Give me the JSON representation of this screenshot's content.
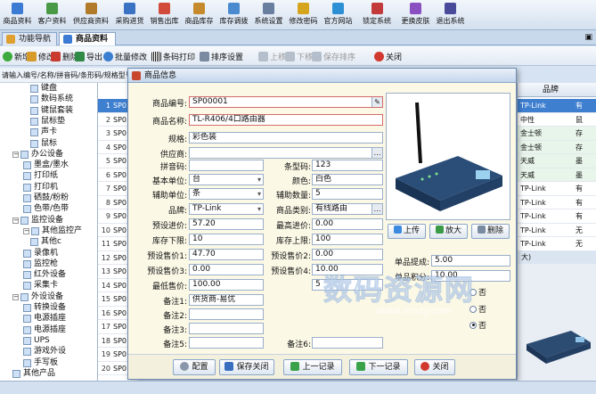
{
  "menu": [
    {
      "label": "商品资料",
      "icon": "grid-icon",
      "color": "#3b7bd3"
    },
    {
      "label": "客户资料",
      "icon": "people-icon",
      "color": "#4a9a45"
    },
    {
      "label": "供应商资料",
      "icon": "truck-icon",
      "color": "#b27b2a"
    },
    {
      "label": "采购进货",
      "icon": "cart-icon",
      "color": "#3a72c4"
    },
    {
      "label": "销售出库",
      "icon": "shop-icon",
      "color": "#d24a3a"
    },
    {
      "label": "商品库存",
      "icon": "box-icon",
      "color": "#c58a2b"
    },
    {
      "label": "库存调拨",
      "icon": "transfer-icon",
      "color": "#4a8bd0"
    },
    {
      "label": "系统设置",
      "icon": "gear-icon",
      "color": "#6a7ea0"
    },
    {
      "label": "修改密码",
      "icon": "key-icon",
      "color": "#d6a51e"
    },
    {
      "label": "官方网站",
      "icon": "globe-icon",
      "color": "#2d8fd4"
    },
    {
      "label": "锁定系统",
      "icon": "lock-icon",
      "color": "#c23a3a"
    },
    {
      "label": "更换皮肤",
      "icon": "palette-icon",
      "color": "#8a4fc0"
    },
    {
      "label": "退出系统",
      "icon": "exit-icon",
      "color": "#4a4a9a"
    }
  ],
  "tabs": [
    {
      "label": "功能导航"
    },
    {
      "label": "商品资料"
    }
  ],
  "toolbar": {
    "new": "新增",
    "edit": "修改",
    "delete": "删除",
    "export": "导出",
    "batch_edit": "批量修改",
    "barcode_print": "条码打印",
    "sort_settings": "排序设置",
    "move_up": "上移",
    "move_down": "下移",
    "save_sort": "保存排序",
    "close": "关闭"
  },
  "breadcrumb": "请输入编号/名称/拼音码/条形码/规格型号",
  "tree": [
    {
      "label": "键盘",
      "level": 3
    },
    {
      "label": "数码系统",
      "level": 3
    },
    {
      "label": "键鼠套装",
      "level": 3
    },
    {
      "label": "鼠标垫",
      "level": 3
    },
    {
      "label": "声卡",
      "level": 3
    },
    {
      "label": "鼠标",
      "level": 3
    },
    {
      "label": "办公设备",
      "level": 1,
      "expanded": true
    },
    {
      "label": "墨盒/墨水",
      "level": 2
    },
    {
      "label": "打印纸",
      "level": 2
    },
    {
      "label": "打印机",
      "level": 2
    },
    {
      "label": "硒鼓/粉粉",
      "level": 2
    },
    {
      "label": "色带/色带",
      "level": 2
    },
    {
      "label": "监控设备",
      "level": 1,
      "expanded": true
    },
    {
      "label": "其他监控产",
      "level": 2,
      "expanded": true
    },
    {
      "label": "其他c",
      "level": 3
    },
    {
      "label": "录像机",
      "level": 2
    },
    {
      "label": "监控枪",
      "level": 2
    },
    {
      "label": "红外设备",
      "level": 2
    },
    {
      "label": "采集卡",
      "level": 2
    },
    {
      "label": "外设设备",
      "level": 1,
      "expanded": true
    },
    {
      "label": "转换设备",
      "level": 2
    },
    {
      "label": "电源插座",
      "level": 2
    },
    {
      "label": "电源插座",
      "level": 2
    },
    {
      "label": "UPS",
      "level": 2
    },
    {
      "label": "游戏外设",
      "level": 2
    },
    {
      "label": "手写板",
      "level": 2
    },
    {
      "label": "其他产品",
      "level": 1
    }
  ],
  "grid_rows": [
    {
      "num": "1",
      "code": "SP0"
    },
    {
      "num": "2",
      "code": "SP0"
    },
    {
      "num": "3",
      "code": "SP0"
    },
    {
      "num": "4",
      "code": "SP0"
    },
    {
      "num": "5",
      "code": "SP0"
    },
    {
      "num": "6",
      "code": "SP0"
    },
    {
      "num": "7",
      "code": "SP0"
    },
    {
      "num": "8",
      "code": "SP0"
    },
    {
      "num": "9",
      "code": "SP0"
    },
    {
      "num": "10",
      "code": "SP0"
    },
    {
      "num": "11",
      "code": "SP0"
    },
    {
      "num": "12",
      "code": "SP0"
    },
    {
      "num": "13",
      "code": "SP0"
    },
    {
      "num": "14",
      "code": "SP0"
    },
    {
      "num": "15",
      "code": "SP0"
    },
    {
      "num": "16",
      "code": "SP0"
    },
    {
      "num": "17",
      "code": "SP0"
    },
    {
      "num": "18",
      "code": "SP0"
    },
    {
      "num": "19",
      "code": "SP0"
    },
    {
      "num": "20",
      "code": "SP0"
    }
  ],
  "right_grid": {
    "header": "品牌",
    "rows": [
      {
        "brand": "TP-Link",
        "extra": "有",
        "tint": false
      },
      {
        "brand": "中性",
        "extra": "鼠",
        "tint": false
      },
      {
        "brand": "金士顿",
        "extra": "存",
        "tint": true
      },
      {
        "brand": "金士顿",
        "extra": "存",
        "tint": true
      },
      {
        "brand": "天威",
        "extra": "墨",
        "tint": true
      },
      {
        "brand": "天威",
        "extra": "墨",
        "tint": true
      },
      {
        "brand": "TP-Link",
        "extra": "有",
        "tint": false
      },
      {
        "brand": "TP-Link",
        "extra": "有",
        "tint": false
      },
      {
        "brand": "TP-Link",
        "extra": "有",
        "tint": false
      },
      {
        "brand": "TP-Link",
        "extra": "无",
        "tint": false
      },
      {
        "brand": "TP-Link",
        "extra": "无",
        "tint": false
      }
    ],
    "image_label": "大)"
  },
  "dialog": {
    "title": "商品信息",
    "fields": {
      "code_label": "商品编号:",
      "code": "SP00001",
      "name_label": "商品名称:",
      "name": "TL-R406/4口路由器",
      "spec_label": "规格:",
      "spec": "彩色装",
      "supplier_label": "供应商:",
      "supplier": "",
      "pinyin_label": "拼音码:",
      "pinyin": "",
      "barcode_label": "条型码:",
      "barcode": "123",
      "unit_label": "基本单位:",
      "unit": "台",
      "color_label": "颜色:",
      "color": "白色",
      "aux_unit_label": "辅助单位:",
      "aux_unit": "条",
      "aux_qty_label": "辅助数量:",
      "aux_qty": "5",
      "brand_label": "品牌:",
      "brand": "TP-Link",
      "category_label": "商品类别:",
      "category": "有线路由",
      "preset_buy_label": "预设进价:",
      "preset_buy": "57.20",
      "min_buy_label": "最高进价:",
      "min_buy": "0.00",
      "stock_low_label": "库存下限:",
      "stock_low": "10",
      "stock_high_label": "库存上限:",
      "stock_high": "100",
      "price1_label": "预设售价1:",
      "price1": "47.70",
      "price2_label": "预设售价2:",
      "price2": "0.00",
      "price3_label": "预设售价3:",
      "price3": "0.00",
      "price4_label": "预设售价4:",
      "price4": "10.00",
      "min_sell_label": "最低售价:",
      "min_sell": "100.00",
      "note1_label": "备注1:",
      "note1": "供货商-易优",
      "note1_right": "5",
      "note2_label": "备注2:",
      "note2": "",
      "note3_label": "备注3:",
      "note3": "",
      "note5_label": "备注5:",
      "note5": "",
      "note6_label": "备注6:",
      "note6": "",
      "commission_label": "单品提成:",
      "commission": "5.00",
      "points_label": "单品积分:",
      "points": "10.00"
    },
    "radio_no": "否",
    "photo_buttons": {
      "upload": "上传",
      "zoom": "放大",
      "delete": "删除"
    },
    "footer": {
      "config": "配置",
      "save_close": "保存关闭",
      "prev": "上一记录",
      "next": "下一记录",
      "close": "关闭"
    }
  },
  "watermark": {
    "text": "数码资源网",
    "url": "www.smzy.com"
  }
}
